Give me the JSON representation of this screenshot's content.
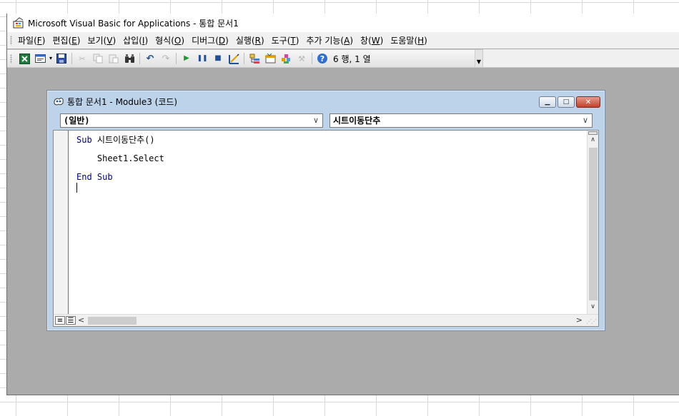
{
  "window": {
    "title": "Microsoft Visual Basic for Applications - 통합 문서1"
  },
  "menu": [
    {
      "label": "파일",
      "key": "F"
    },
    {
      "label": "편집",
      "key": "E"
    },
    {
      "label": "보기",
      "key": "V"
    },
    {
      "label": "삽입",
      "key": "I"
    },
    {
      "label": "형식",
      "key": "O"
    },
    {
      "label": "디버그",
      "key": "D"
    },
    {
      "label": "실행",
      "key": "R"
    },
    {
      "label": "도구",
      "key": "T"
    },
    {
      "label": "추가 기능",
      "key": "A"
    },
    {
      "label": "창",
      "key": "W"
    },
    {
      "label": "도움말",
      "key": "H"
    }
  ],
  "toolbar": {
    "cursor_position": "6 행, 1 열",
    "icons": [
      "excel-view-icon",
      "insert-module-icon",
      "save-icon",
      "cut-icon",
      "copy-icon",
      "paste-icon",
      "find-icon",
      "undo-icon",
      "redo-icon",
      "run-icon",
      "break-icon",
      "reset-icon",
      "design-mode-icon",
      "project-explorer-icon",
      "properties-icon",
      "object-browser-icon",
      "toolbox-icon",
      "help-icon"
    ]
  },
  "code_window": {
    "title": "통합 문서1 - Module3 (코드)",
    "object_combo": "(일반)",
    "procedure_combo": "시트이동단추",
    "code": {
      "line1_kw": "Sub",
      "line1_rest": " 시트이동단추()",
      "line2": "    Sheet1.Select",
      "line3_kw1": "End",
      "line3_kw2": "Sub"
    }
  },
  "colors": {
    "vbe_background": "#ababab",
    "code_window_frame": "#bcd3ea",
    "keyword": "#00008b"
  }
}
